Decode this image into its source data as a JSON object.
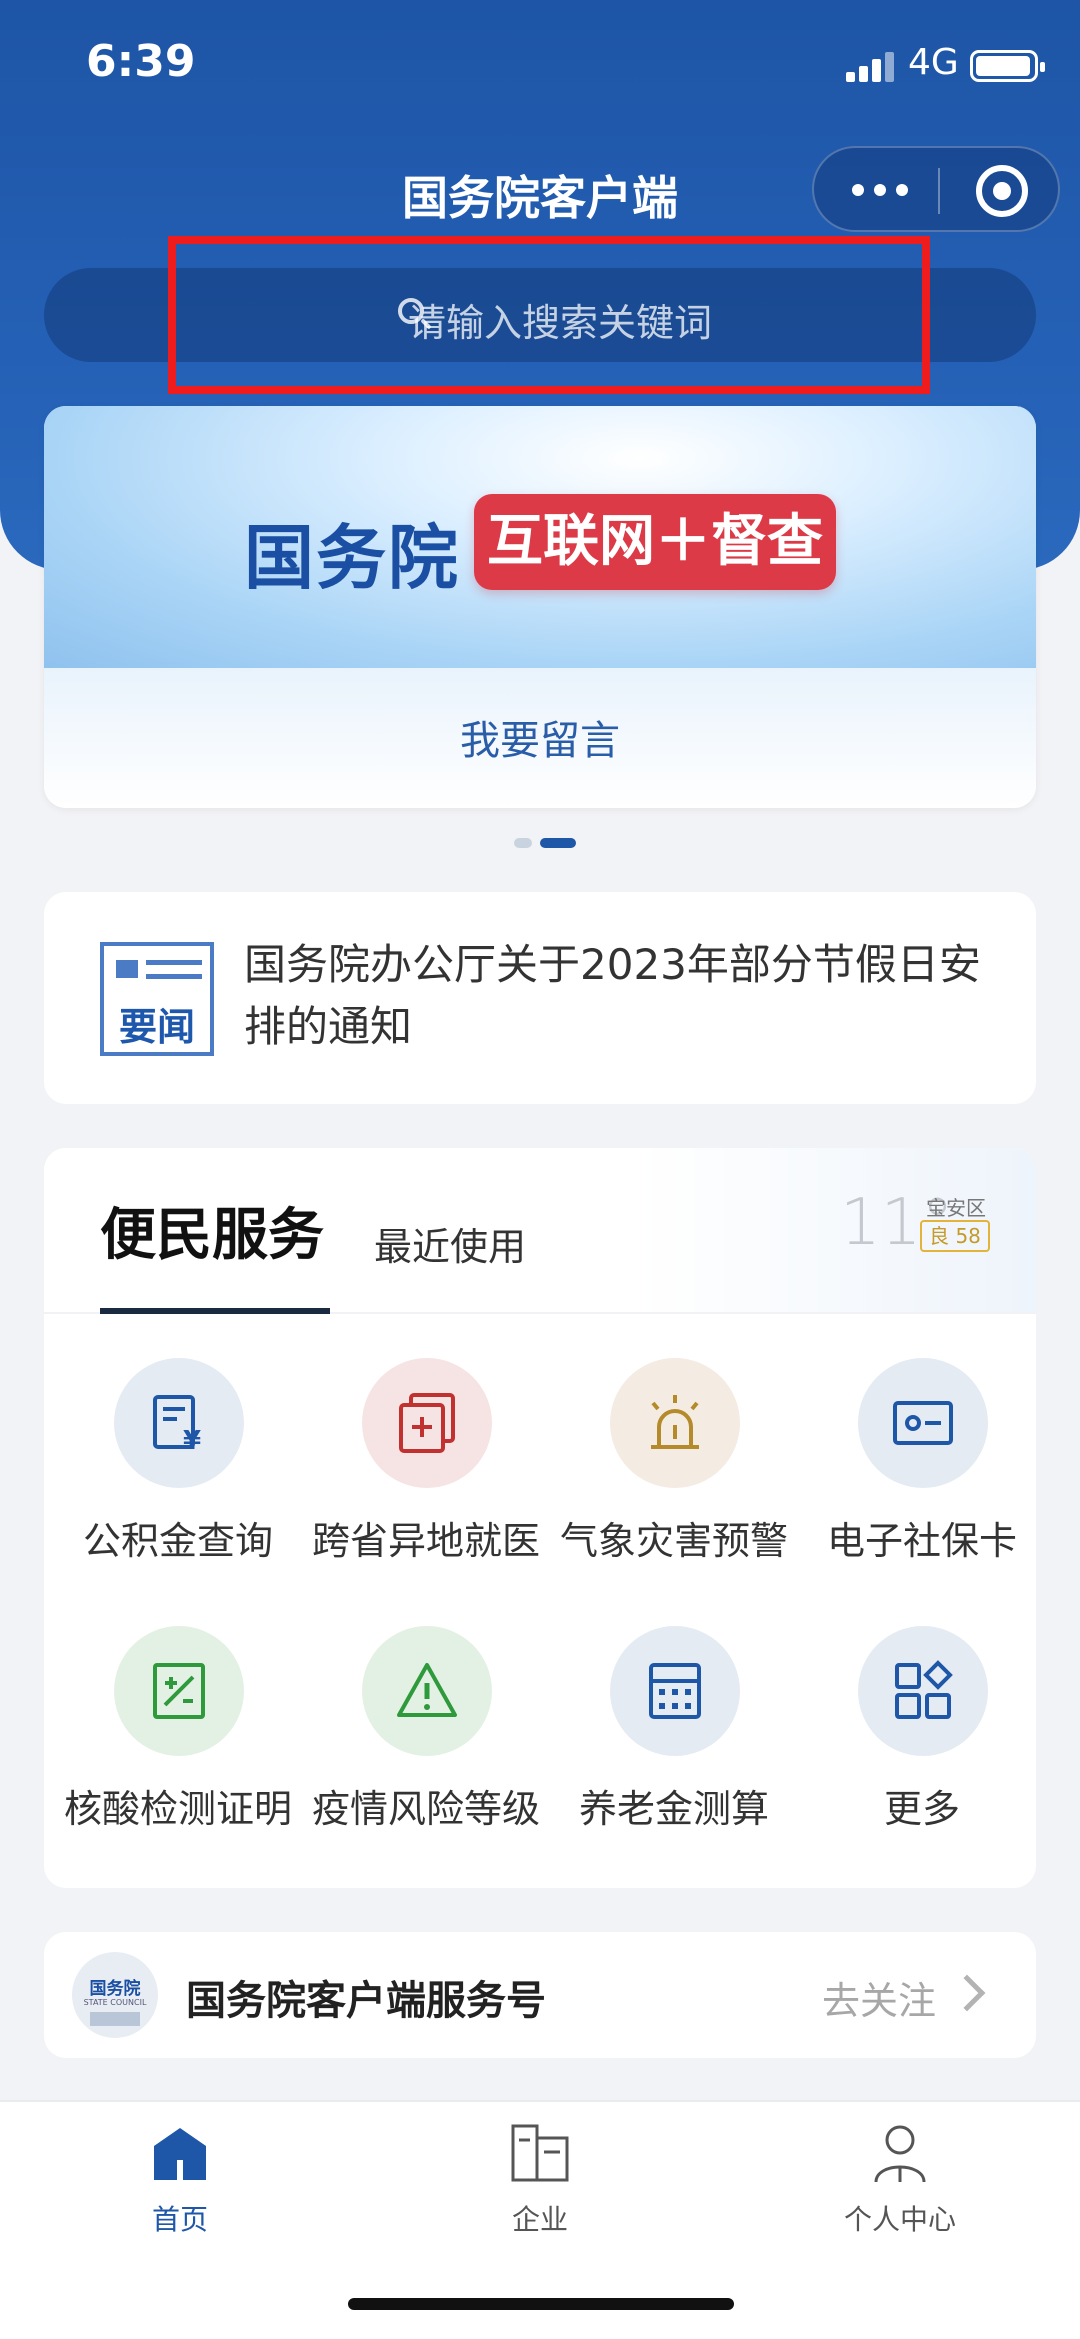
{
  "status_bar": {
    "time": "6:39",
    "network": "4G"
  },
  "header": {
    "title": "国务院客户端"
  },
  "search": {
    "placeholder": "请输入搜索关键词"
  },
  "banner": {
    "logo_text": "国务院",
    "tag_text": "互联网＋督查",
    "cta": "我要留言",
    "page_count": 2,
    "active_page": 2
  },
  "news": {
    "badge": "要闻",
    "headline": "国务院办公厅关于2023年部分节假日安排的通知"
  },
  "services": {
    "tab_main": "便民服务",
    "tab_recent": "最近使用",
    "weather": {
      "temperature": "11°",
      "district": "宝安区",
      "aqi": "良 58"
    },
    "items": [
      {
        "label": "公积金查询",
        "icon": "housing-fund-icon",
        "bg": "#e5ebf3",
        "color": "#1e56a8"
      },
      {
        "label": "跨省异地就医",
        "icon": "medical-icon",
        "bg": "#f6e4e4",
        "color": "#c0312f"
      },
      {
        "label": "气象灾害预警",
        "icon": "weather-alarm-icon",
        "bg": "#f4ebe2",
        "color": "#b58a2a"
      },
      {
        "label": "电子社保卡",
        "icon": "social-card-icon",
        "bg": "#e5ebf3",
        "color": "#1e56a8"
      },
      {
        "label": "核酸检测证明",
        "icon": "test-certificate-icon",
        "bg": "#e3f1e4",
        "color": "#2f9a3b"
      },
      {
        "label": "疫情风险等级",
        "icon": "risk-warning-icon",
        "bg": "#e3f1e4",
        "color": "#2f9a3b"
      },
      {
        "label": "养老金测算",
        "icon": "calculator-icon",
        "bg": "#e5ebf3",
        "color": "#1e56a8"
      },
      {
        "label": "更多",
        "icon": "more-apps-icon",
        "bg": "#e5ebf3",
        "color": "#1e56a8"
      }
    ]
  },
  "follow": {
    "avatar_text": "国务院",
    "avatar_sub": "STATE COUNCIL",
    "title": "国务院客户端服务号",
    "cta": "去关注"
  },
  "tabbar": {
    "items": [
      {
        "label": "首页",
        "active": true
      },
      {
        "label": "企业",
        "active": false
      },
      {
        "label": "个人中心",
        "active": false
      }
    ],
    "active_color": "#1e56a8",
    "inactive_color": "#555555"
  }
}
